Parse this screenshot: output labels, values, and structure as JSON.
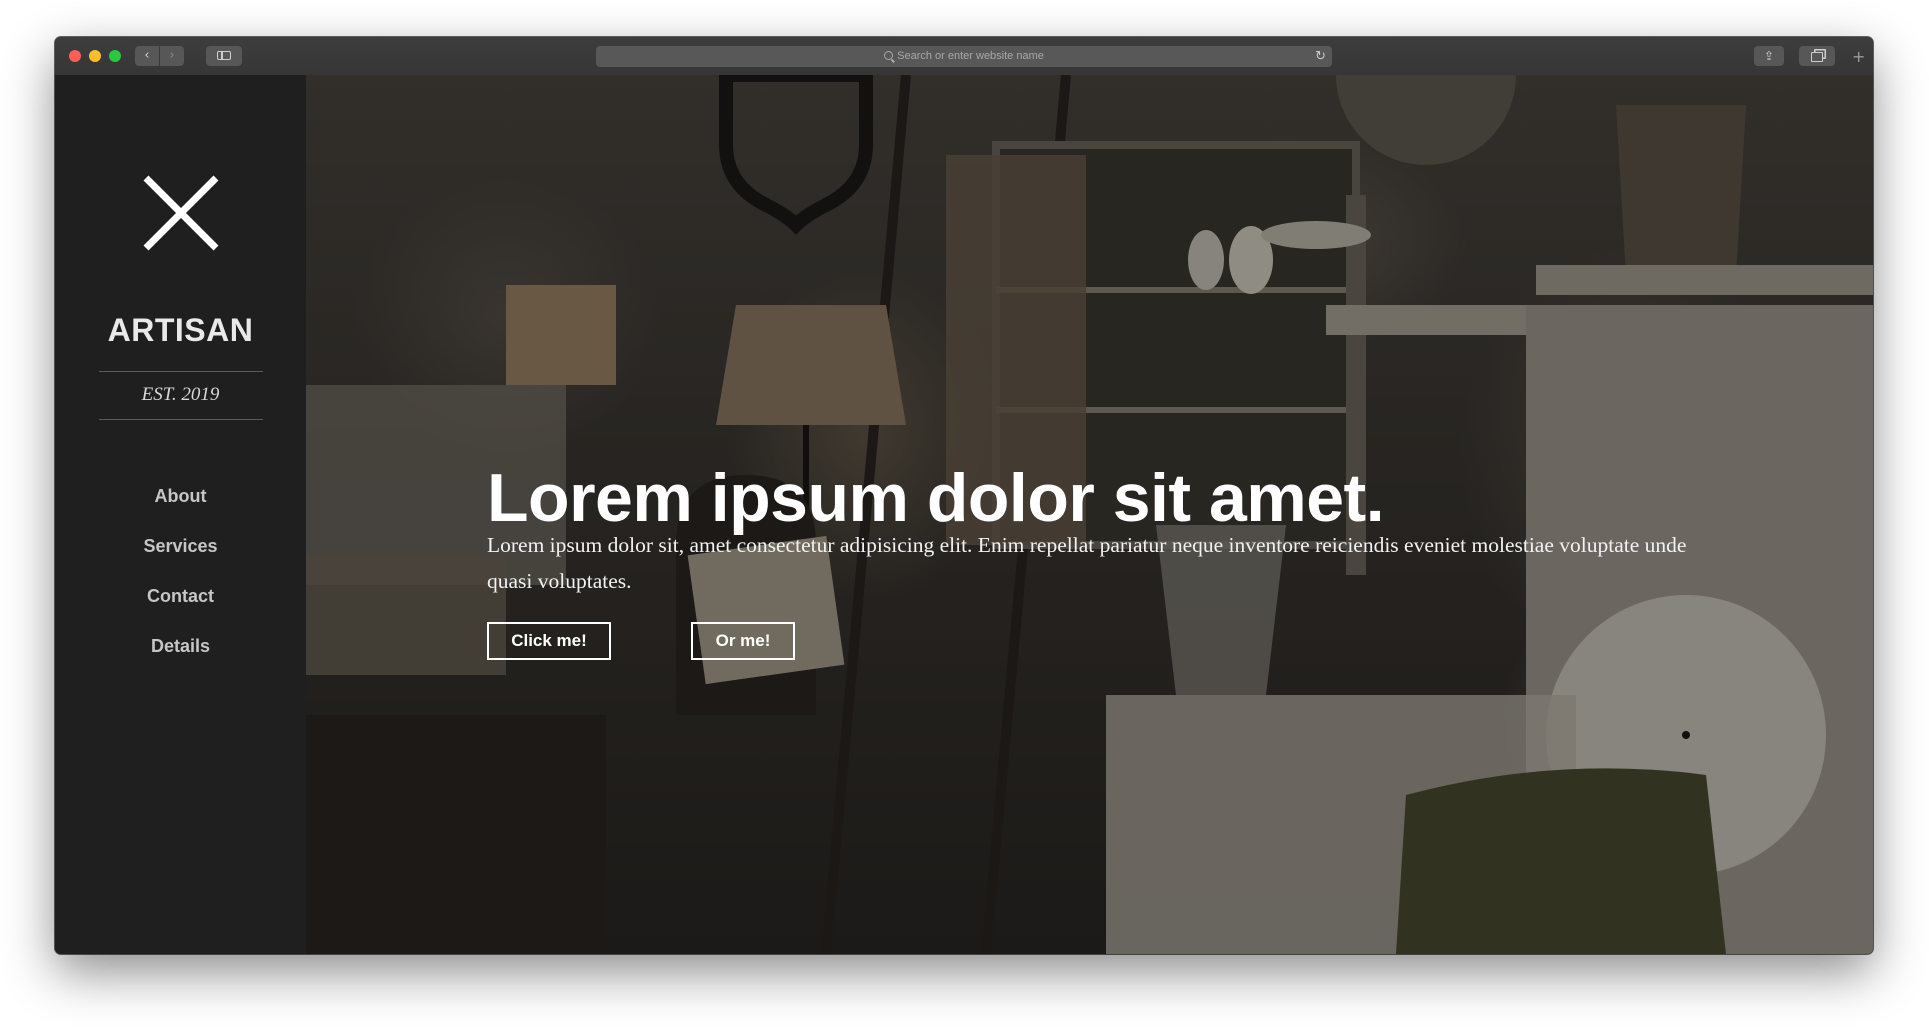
{
  "browser": {
    "url_placeholder": "Search or enter website name",
    "back_glyph": "‹",
    "forward_glyph": "›",
    "reload_glyph": "↻",
    "share_glyph": "⇪",
    "new_tab_glyph": "+"
  },
  "sidebar": {
    "brand": "ARTISAN",
    "established": "EST. 2019",
    "nav": [
      "About",
      "Services",
      "Contact",
      "Details"
    ]
  },
  "hero": {
    "title": "Lorem ipsum dolor sit amet.",
    "body": "Lorem ipsum dolor sit, amet consectetur adipisicing elit. Enim repellat pariatur neque inventore reiciendis eveniet molestiae voluptate unde quasi voluptates.",
    "primary_button": "Click me!",
    "secondary_button": "Or me!"
  },
  "colors": {
    "sidebar_bg": "#1f1f1f",
    "hero_text": "#ffffff",
    "titlebar": "#3a3a3a"
  }
}
